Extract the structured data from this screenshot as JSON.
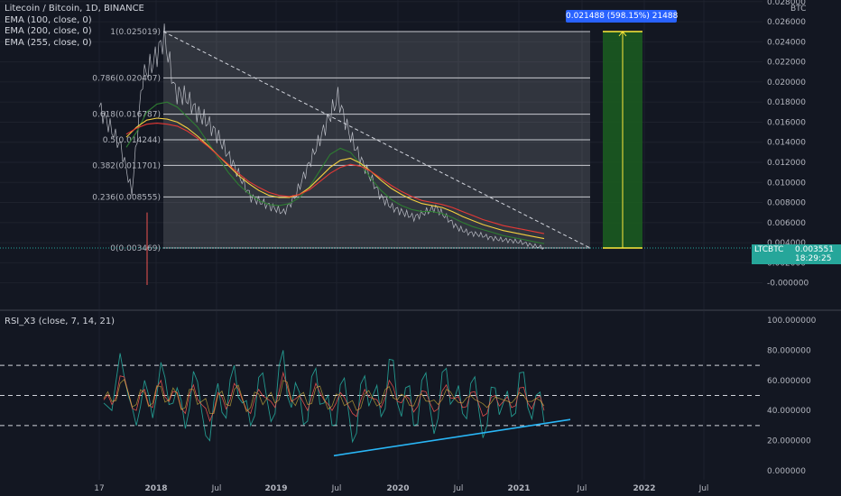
{
  "legend": {
    "symbol": "Litecoin / Bitcoin, 1D, BINANCE",
    "ema1": "EMA (100, close, 0)",
    "ema2": "EMA (200, close, 0)",
    "ema3": "EMA (255, close, 0)"
  },
  "rsi_legend": "RSI_X3 (close, 7, 14, 21)",
  "axis_unit": "BTC",
  "measure_label": "0.021488 (598.15%) 21488",
  "price_tag": {
    "symbol": "LTCBTC",
    "price": "0.003551",
    "countdown": "18:29:25"
  },
  "colors": {
    "background": "#131722",
    "price_line": "#d1d4dc",
    "ema100": "#2e7d32",
    "ema200": "#f4d03f",
    "ema255": "#e53935",
    "measure_fill": "#1b5e20",
    "measure_accent": "#ffeb3b",
    "trendline": "#29b6f6",
    "rsi_fast": "#26a69a",
    "rsi_mid": "#ef5350",
    "price_tag": "#26a69a",
    "badge": "#2962ff"
  },
  "chart_data": [
    {
      "type": "line",
      "title": "Litecoin / Bitcoin, 1D, BINANCE",
      "ylabel": "BTC",
      "ylim": [
        -0.0015,
        0.028
      ],
      "price_ticks": [
        "0.028000",
        "0.026000",
        "0.024000",
        "0.022000",
        "0.020000",
        "0.018000",
        "0.016000",
        "0.014000",
        "0.012000",
        "0.010000",
        "0.008000",
        "0.006000",
        "0.004000",
        "0.002000",
        "-0.000000"
      ],
      "time_ticks": [
        "17",
        "2018",
        "Jul",
        "2019",
        "Jul",
        "2020",
        "Jul",
        "2021",
        "Jul",
        "2022",
        "Jul"
      ],
      "fib_levels": [
        {
          "label": "1(0.025019)",
          "value": 0.025019
        },
        {
          "label": "0.786(0.020407)",
          "value": 0.020407
        },
        {
          "label": "0.618(0.016787)",
          "value": 0.016787
        },
        {
          "label": "0.5(0.014244)",
          "value": 0.014244
        },
        {
          "label": "0.382(0.011701)",
          "value": 0.011701
        },
        {
          "label": "0.236(0.008555)",
          "value": 0.008555
        },
        {
          "label": "0(0.003469)",
          "value": 0.003469
        }
      ],
      "series": [
        {
          "values": [
            0.0175,
            0.0155,
            0.0135,
            0.009,
            0.0205,
            0.022,
            0.0245,
            0.019,
            0.0185,
            0.017,
            0.016,
            0.0145,
            0.0125,
            0.0105,
            0.0085,
            0.008,
            0.0075,
            0.007,
            0.0085,
            0.011,
            0.0135,
            0.016,
            0.0185,
            0.015,
            0.0125,
            0.0105,
            0.0085,
            0.0075,
            0.007,
            0.0065,
            0.007,
            0.0075,
            0.0065,
            0.0055,
            0.005,
            0.0048,
            0.0045,
            0.0043,
            0.0042,
            0.004,
            0.0037,
            0.0035
          ]
        },
        {
          "name": "EMA (100, close, 0)",
          "values": [
            0.0135,
            0.015,
            0.017,
            0.0178,
            0.018,
            0.0175,
            0.0165,
            0.0155,
            0.014,
            0.0125,
            0.011,
            0.0098,
            0.0089,
            0.0082,
            0.0078,
            0.0077,
            0.0079,
            0.0085,
            0.0096,
            0.0112,
            0.0128,
            0.0134,
            0.013,
            0.0118,
            0.0104,
            0.0092,
            0.0083,
            0.0077,
            0.0073,
            0.0071,
            0.0071,
            0.0069,
            0.0065,
            0.006,
            0.0056,
            0.0053,
            0.005,
            0.0047,
            0.0045,
            0.0043,
            0.0041,
            0.0039
          ]
        },
        {
          "name": "EMA (200, close, 0)",
          "values": [
            0.0145,
            0.0155,
            0.0162,
            0.0164,
            0.0163,
            0.016,
            0.0154,
            0.0146,
            0.0137,
            0.0127,
            0.0117,
            0.0107,
            0.0099,
            0.0092,
            0.0087,
            0.0085,
            0.0085,
            0.0088,
            0.0095,
            0.0105,
            0.0115,
            0.0122,
            0.0124,
            0.0119,
            0.0111,
            0.0102,
            0.0094,
            0.0088,
            0.0083,
            0.0079,
            0.0077,
            0.0075,
            0.0071,
            0.0066,
            0.0062,
            0.0058,
            0.0055,
            0.0052,
            0.005,
            0.0048,
            0.0046,
            0.0044
          ]
        },
        {
          "name": "EMA (255, close, 0)",
          "values": [
            0.0148,
            0.0154,
            0.0158,
            0.0159,
            0.0158,
            0.0156,
            0.0151,
            0.0144,
            0.0136,
            0.0127,
            0.0118,
            0.0109,
            0.0101,
            0.0095,
            0.009,
            0.0087,
            0.0086,
            0.0088,
            0.0093,
            0.0101,
            0.0109,
            0.0115,
            0.0118,
            0.0116,
            0.0111,
            0.0104,
            0.0097,
            0.0091,
            0.0086,
            0.0082,
            0.008,
            0.0078,
            0.0075,
            0.0071,
            0.0067,
            0.0063,
            0.006,
            0.0057,
            0.0055,
            0.0053,
            0.0051,
            0.0049
          ]
        }
      ],
      "measure": {
        "from": 0.003469,
        "to": 0.025019
      }
    },
    {
      "type": "line",
      "title": "RSI_X3 (close, 7, 14, 21)",
      "ylim": [
        -5,
        100
      ],
      "ticks": [
        "100.000000",
        "80.000000",
        "60.000000",
        "40.000000",
        "20.000000",
        "0.000000"
      ],
      "bands": [
        70,
        50,
        30
      ],
      "series": [
        {
          "values": [
            45,
            40,
            78,
            50,
            30,
            60,
            35,
            72,
            44,
            55,
            28,
            66,
            40,
            20,
            58,
            35,
            70,
            45,
            30,
            62,
            48,
            38,
            80,
            42,
            52,
            33,
            68,
            45,
            30,
            57,
            40,
            25,
            63,
            50,
            36,
            74,
            45,
            55,
            30,
            60,
            42,
            35,
            68,
            48,
            38,
            58,
            40,
            30,
            55,
            45,
            36,
            65,
            42,
            50,
            32
          ]
        },
        {
          "values": [
            47,
            44,
            63,
            52,
            40,
            54,
            42,
            60,
            46,
            52,
            38,
            57,
            44,
            33,
            52,
            41,
            58,
            47,
            38,
            54,
            48,
            42,
            65,
            46,
            50,
            40,
            58,
            47,
            40,
            52,
            43,
            36,
            54,
            48,
            42,
            60,
            46,
            50,
            39,
            53,
            45,
            41,
            57,
            48,
            42,
            52,
            44,
            38,
            50,
            46,
            42,
            55,
            45,
            48,
            40
          ]
        },
        {
          "values": [
            48,
            46,
            58,
            52,
            44,
            52,
            45,
            56,
            47,
            51,
            42,
            54,
            46,
            38,
            50,
            44,
            54,
            48,
            42,
            51,
            48,
            45,
            60,
            47,
            50,
            44,
            55,
            48,
            43,
            50,
            45,
            40,
            51,
            48,
            45,
            56,
            47,
            49,
            43,
            51,
            46,
            44,
            54,
            48,
            45,
            50,
            46,
            42,
            49,
            47,
            45,
            52,
            46,
            48,
            43
          ]
        }
      ],
      "trendline": {
        "from": {
          "x": "2019-Jul",
          "y": 10
        },
        "to": {
          "x": "2021-Jul",
          "y": 33
        }
      }
    }
  ]
}
